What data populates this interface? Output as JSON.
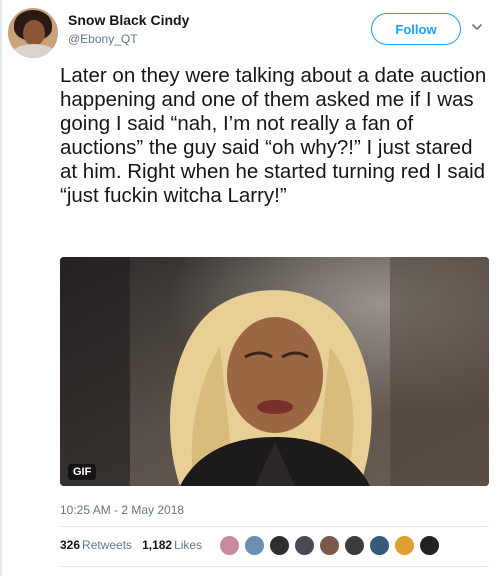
{
  "tweet": {
    "user": {
      "name": "Snow Black Cindy",
      "handle": "@Ebony_QT"
    },
    "follow_label": "Follow",
    "text": "Later on they were talking about a date auction happening and one of them asked me if I was going I said “nah, I’m not really a fan of auctions” the guy said “oh why?!” I just stared at him. Right when he started turning red I said “just fuckin witcha Larry!”",
    "media": {
      "badge": "GIF"
    },
    "timestamp": "10:25 AM - 2 May 2018",
    "stats": {
      "retweets_count": "326",
      "retweets_label": "Retweets",
      "likes_count": "1,182",
      "likes_label": "Likes"
    },
    "liker_avatar_colors": [
      "#c98aa0",
      "#6b8fb0",
      "#2e2e2e",
      "#4a4a55",
      "#7a5a48",
      "#3c3c3c",
      "#355a7a",
      "#e0a030",
      "#222222"
    ]
  },
  "colors": {
    "accent": "#1da1f2",
    "secondary_text": "#657786",
    "primary_text": "#14171a"
  }
}
